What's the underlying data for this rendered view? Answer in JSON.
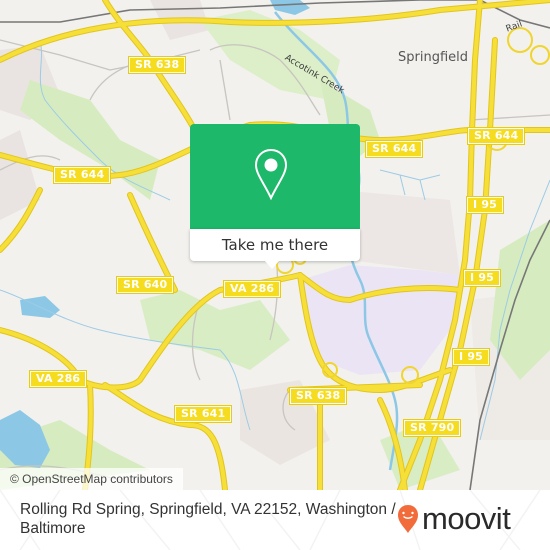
{
  "map": {
    "place_labels": [
      {
        "name": "Springfield"
      }
    ],
    "water_labels": [
      {
        "name": "Accotink Creek"
      }
    ],
    "rail_label": "Rail",
    "road_shields": [
      {
        "label": "SR 638"
      },
      {
        "label": "SR 644"
      },
      {
        "label": "SR 644"
      },
      {
        "label": "SR 644"
      },
      {
        "label": "I 95"
      },
      {
        "label": "I 95"
      },
      {
        "label": "I 95"
      },
      {
        "label": "SR 640"
      },
      {
        "label": "VA 286"
      },
      {
        "label": "VA 286"
      },
      {
        "label": "SR 638"
      },
      {
        "label": "SR 641"
      },
      {
        "label": "SR 790"
      }
    ],
    "colors": {
      "background": "#f2f1ed",
      "road_major": "#f5dc1e",
      "water": "#8cc8e6",
      "park": "#d6ecc0",
      "industrial": "#ebe4f5",
      "urban": "#e7e1de"
    }
  },
  "popup": {
    "icon": "map-pin-icon",
    "button_label": "Take me there",
    "color": "#1db86a"
  },
  "attribution": "© OpenStreetMap contributors",
  "footer": {
    "address": "Rolling Rd Spring, Springfield, VA 22152, Washington / Baltimore",
    "brand": "moovit",
    "brand_color": "#f26b3a"
  }
}
